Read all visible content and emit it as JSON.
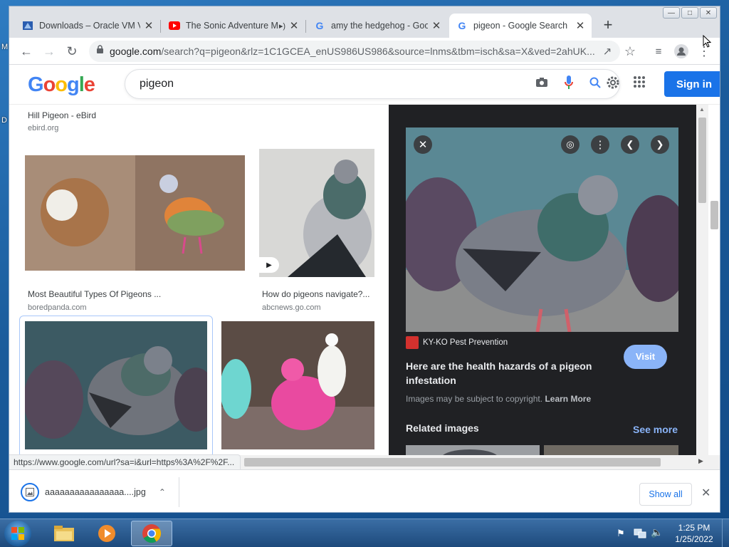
{
  "desktop": {
    "left_labels": [
      "M",
      "D"
    ]
  },
  "window": {
    "caption_buttons": [
      "minimize-icon",
      "maximize-icon",
      "close-icon"
    ]
  },
  "tabs": [
    {
      "title": "Downloads – Oracle VM V",
      "icon": "virtualbox-icon",
      "active": false
    },
    {
      "title": "The Sonic Adventure M",
      "icon": "youtube-icon",
      "audio": true,
      "active": false
    },
    {
      "title": "amy the hedgehog - Goo",
      "icon": "google-g-icon",
      "active": false
    },
    {
      "title": "pigeon - Google Search",
      "icon": "google-g-icon",
      "active": true
    }
  ],
  "newtab_symbol": "+",
  "omnibox": {
    "url_host": "google.com",
    "url_rest": "/search?q=pigeon&rlz=1C1GCEA_enUS986US986&source=lnms&tbm=isch&sa=X&ved=2ahUK..."
  },
  "google": {
    "logo_letters": [
      "G",
      "o",
      "o",
      "g",
      "l",
      "e"
    ],
    "logo_colors": [
      "#4285f4",
      "#ea4335",
      "#fbbc05",
      "#4285f4",
      "#34a853",
      "#ea4335"
    ],
    "query": "pigeon",
    "sign_in": "Sign in"
  },
  "results": {
    "top": {
      "title": "Hill Pigeon - eBird",
      "source": "ebird.org"
    },
    "items": [
      {
        "title": "Most Beautiful Types Of Pigeons ...",
        "source": "boredpanda.com"
      },
      {
        "title": "How do pigeons navigate?...",
        "source": "abcnews.go.com",
        "has_video": true
      }
    ]
  },
  "panel": {
    "source_name": "KY-KO Pest Prevention",
    "title": "Here are the health hazards of a pigeon infestation",
    "visit": "Visit",
    "copyright": "Images may be subject to copyright.",
    "learn_more": "Learn More",
    "related": "Related images",
    "see_more": "See more"
  },
  "status_url": "https://www.google.com/url?sa=i&url=https%3A%2F%2F...",
  "download": {
    "filename": "aaaaaaaaaaaaaaaa....jpg",
    "show_all": "Show all"
  },
  "clock": {
    "time": "1:25 PM",
    "date": "1/25/2022"
  }
}
